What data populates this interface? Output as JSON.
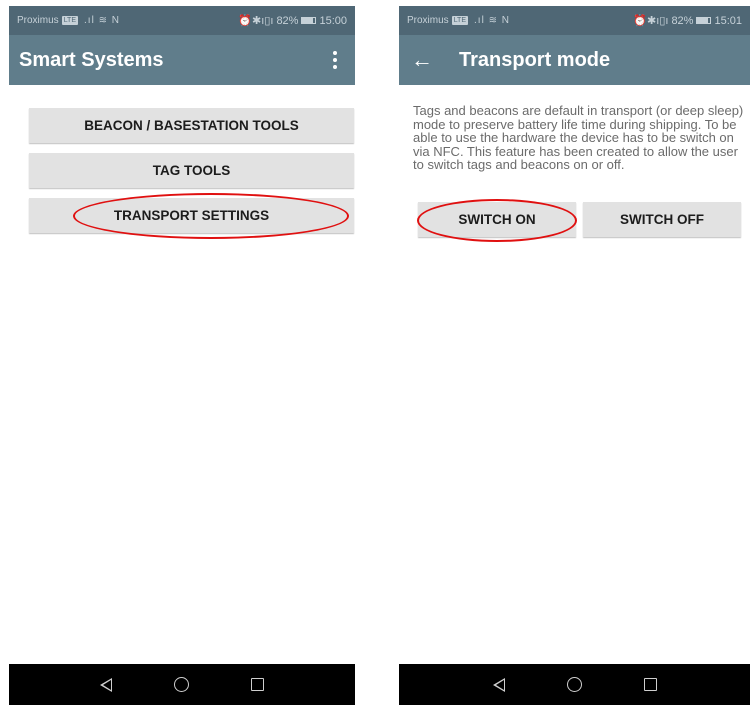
{
  "left": {
    "statusbar": {
      "carrier": "Proximus",
      "network": "LTE",
      "signal": ".ıl ≋ N",
      "icons": "⏰✱ı▯ı",
      "battery": "82%",
      "time": "15:00"
    },
    "appbar": {
      "title": "Smart Systems",
      "menu_icon": "more-vert-icon"
    },
    "buttons": {
      "beacon": "BEACON / BASESTATION TOOLS",
      "tag": "TAG TOOLS",
      "transport": "TRANSPORT SETTINGS"
    },
    "annotation_color": "#e01010"
  },
  "right": {
    "statusbar": {
      "carrier": "Proximus",
      "network": "LTE",
      "signal": ".ıl ≋ N",
      "icons": "⏰✱ı▯ı",
      "battery": "82%",
      "time": "15:01"
    },
    "appbar": {
      "title": "Transport mode",
      "back_icon": "←"
    },
    "description": "Tags and beacons are default in transport (or deep sleep) mode to preserve battery life time during shipping. To be able to use the hardware the device has to be switch on via NFC. This feature has been created to allow the user to switch tags and beacons on or off.",
    "buttons": {
      "switch_on": "SWITCH ON",
      "switch_off": "SWITCH OFF"
    }
  },
  "colors": {
    "appbar": "#607d8b",
    "statusbar": "#4f6775",
    "button": "#e2e2e2",
    "highlight": "#e01010"
  }
}
